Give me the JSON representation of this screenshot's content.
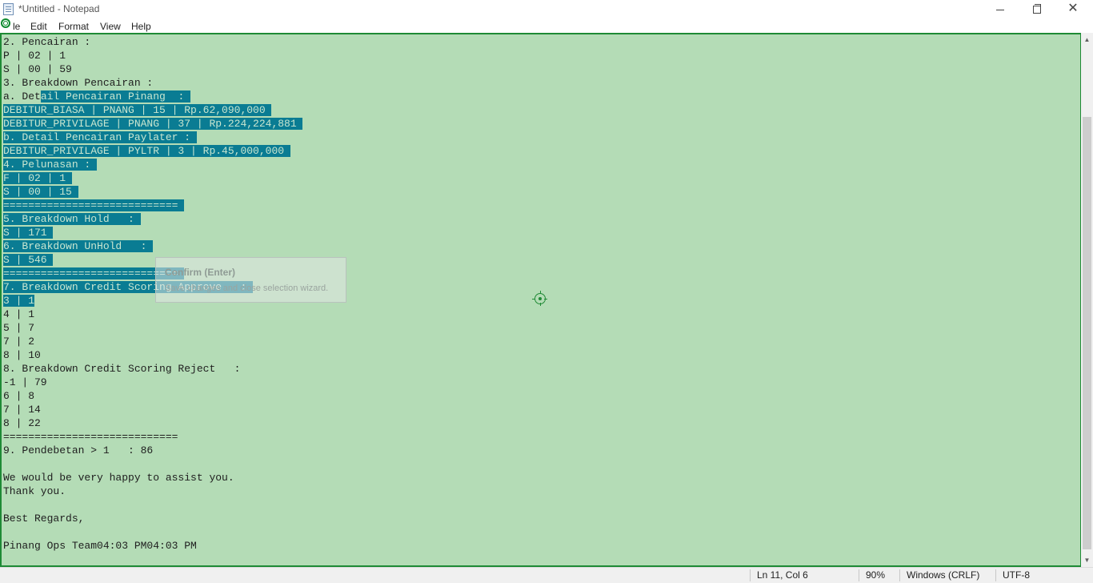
{
  "window": {
    "title": "*Untitled - Notepad",
    "min_glyph": "",
    "max_glyph": "",
    "close_glyph": "✕"
  },
  "menu": {
    "file": "le",
    "edit": "Edit",
    "format": "Format",
    "view": "View",
    "help": "Help"
  },
  "document": {
    "lines": [
      "2. Pencairan :",
      "P | 02 | 1",
      "S | 00 | 59",
      "3. Breakdown Pencairan :",
      "a. Detail Pencairan Pinang  :",
      "DEBITUR_BIASA | PNANG | 15 | Rp.62,090,000",
      "DEBITUR_PRIVILAGE | PNANG | 37 | Rp.224,224,881",
      "b. Detail Pencairan Paylater :",
      "DEBITUR_PRIVILAGE | PYLTR | 3 | Rp.45,000,000",
      "4. Pelunasan :",
      "F | 02 | 1",
      "S | 00 | 15",
      "============================",
      "5. Breakdown Hold   :",
      "S | 171",
      "6. Breakdown UnHold   :",
      "S | 546",
      "============================",
      "7. Breakdown Credit Scoring Approve   :",
      "3 | 1",
      "4 | 1",
      "5 | 7",
      "7 | 2",
      "8 | 10",
      "8. Breakdown Credit Scoring Reject   :",
      "-1 | 79",
      "6 | 8",
      "7 | 14",
      "8 | 22",
      "============================",
      "9. Pendebetan > 1   : 86",
      "",
      "We would be very happy to assist you.",
      "Thank you.",
      "",
      "Best Regards,",
      "",
      "Pinang Ops Team04:03 PM04:03 PM"
    ]
  },
  "tooltip": {
    "title": "Confirm (Enter)",
    "description": "Save changes and close selection wizard."
  },
  "status": {
    "position": "Ln 11, Col 6",
    "zoom": "90%",
    "line_ending": "Windows (CRLF)",
    "encoding": "UTF-8"
  },
  "colors": {
    "editor_background": "#b4dcb6",
    "selection": "#0a7c93",
    "border_accent": "#1e8a35"
  },
  "icons": {
    "app": "notepad-icon",
    "overlay": "target-logo-icon",
    "cursor": "crosshair-target-icon"
  }
}
